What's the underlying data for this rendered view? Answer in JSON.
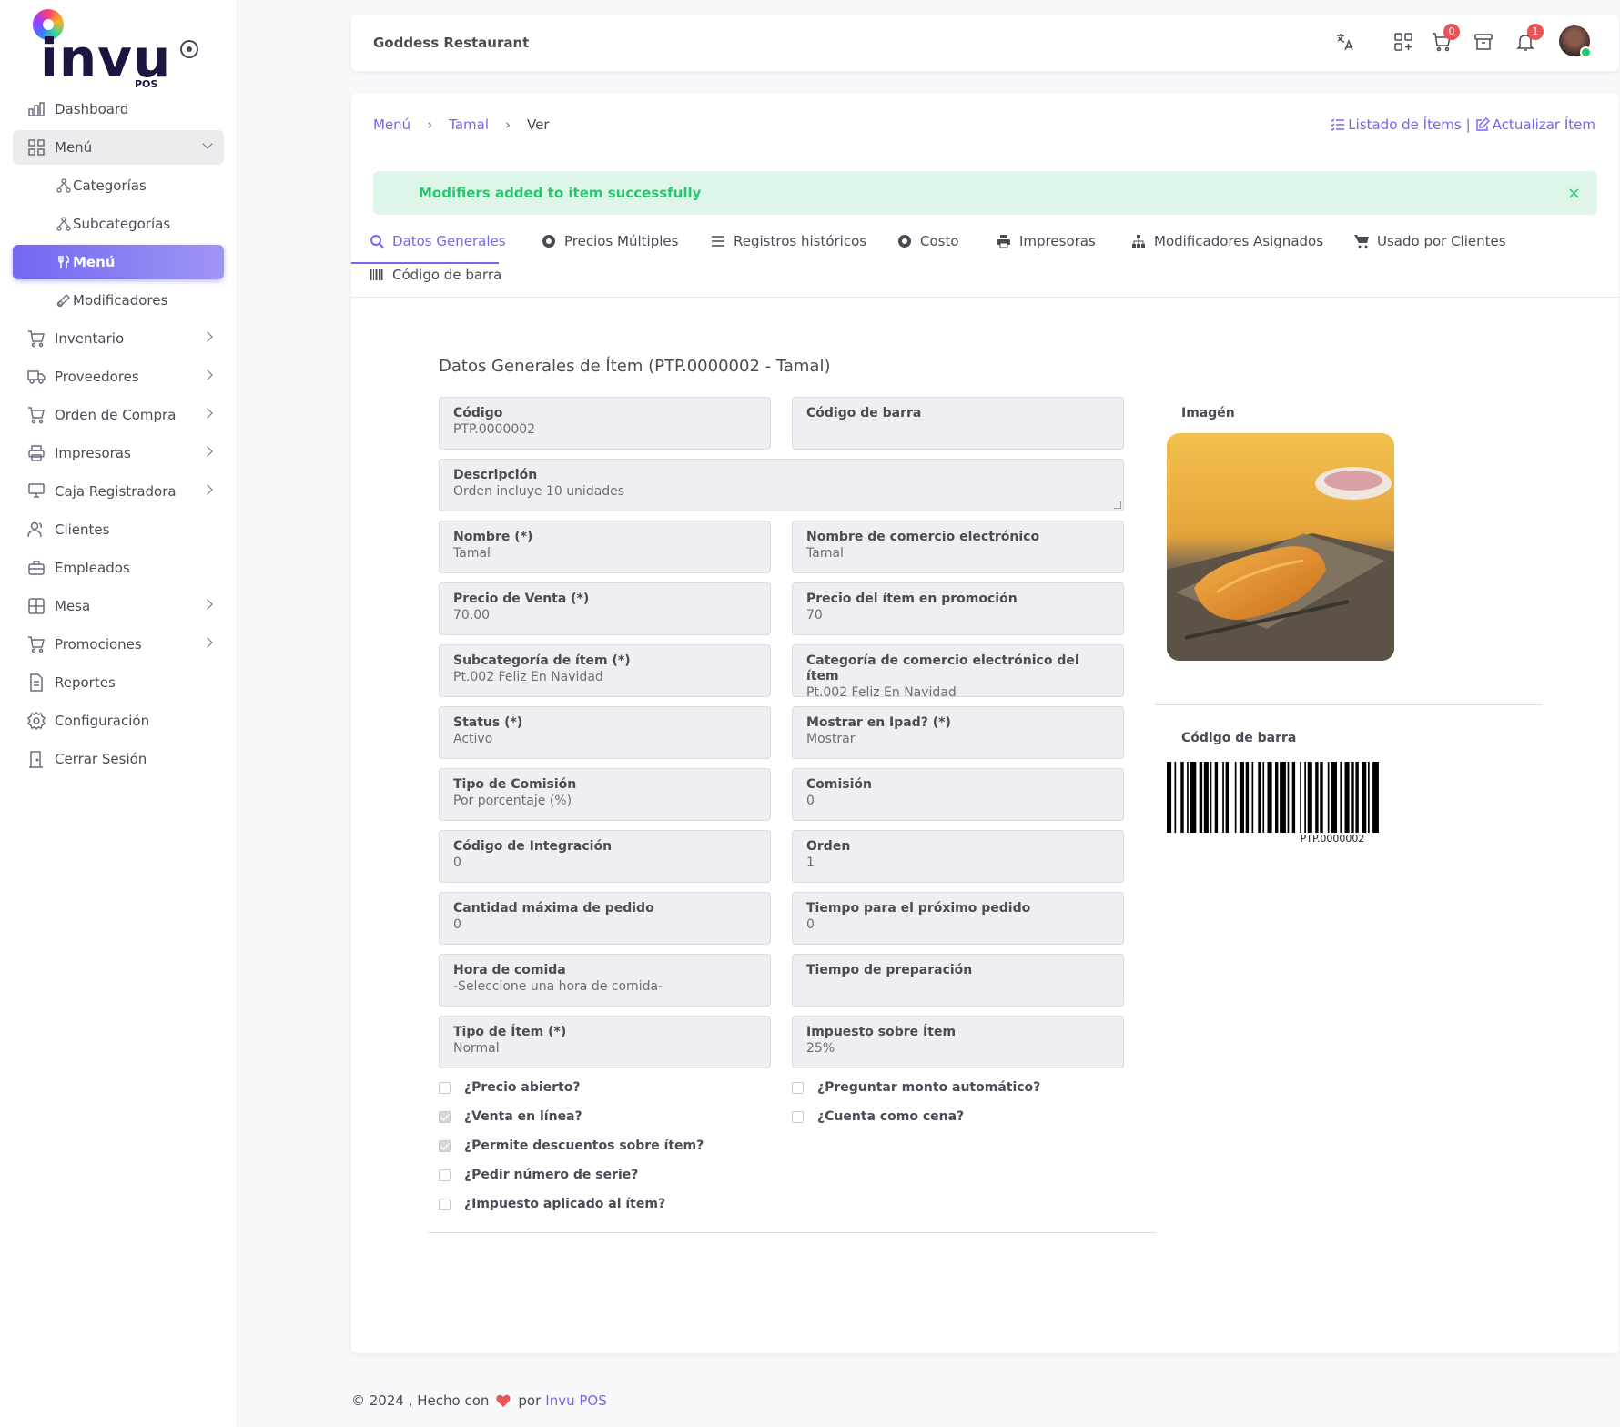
{
  "brand": {
    "name": "invu",
    "sub": "POS"
  },
  "sidebar": {
    "items": [
      {
        "label": "Dashboard",
        "icon": "chart-bar-icon"
      },
      {
        "label": "Menú",
        "icon": "grid-icon",
        "open": true,
        "children": [
          {
            "label": "Categorías",
            "icon": "hierarchy-icon"
          },
          {
            "label": "Subcategorías",
            "icon": "hierarchy-icon"
          },
          {
            "label": "Menú",
            "icon": "tools-kitchen-icon",
            "active": true
          },
          {
            "label": "Modificadores",
            "icon": "edit-circle-icon"
          }
        ]
      },
      {
        "label": "Inventario",
        "icon": "shopping-cart-icon"
      },
      {
        "label": "Proveedores",
        "icon": "truck-icon"
      },
      {
        "label": "Orden de Compra",
        "icon": "cart-icon"
      },
      {
        "label": "Impresoras",
        "icon": "printer-icon"
      },
      {
        "label": "Caja Registradora",
        "icon": "cash-register-icon"
      },
      {
        "label": "Clientes",
        "icon": "users-icon"
      },
      {
        "label": "Empleados",
        "icon": "briefcase-icon"
      },
      {
        "label": "Mesa",
        "icon": "table-icon"
      },
      {
        "label": "Promociones",
        "icon": "cart-icon"
      },
      {
        "label": "Reportes",
        "icon": "file-report-icon"
      },
      {
        "label": "Configuración",
        "icon": "settings-icon"
      },
      {
        "label": "Cerrar Sesión",
        "icon": "door-exit-icon"
      }
    ]
  },
  "topbar": {
    "title": "Goddess Restaurant",
    "cart_count": "0",
    "notif_count": "1"
  },
  "breadcrumb": {
    "items": [
      "Menú",
      "Tamal",
      "Ver"
    ]
  },
  "actions": {
    "list": "Listado de Ítems",
    "update": "Actualizar Ítem",
    "divider": "|"
  },
  "alert": {
    "message": "Modifiers added to item successfully",
    "close": "×"
  },
  "tabs": [
    {
      "label": "Datos Generales",
      "icon": "search-icon",
      "active": true
    },
    {
      "label": "Precios Múltiples",
      "icon": "coin-icon"
    },
    {
      "label": "Registros históricos",
      "icon": "list-icon"
    },
    {
      "label": "Costo",
      "icon": "coin-icon"
    },
    {
      "label": "Impresoras",
      "icon": "printer-icon"
    },
    {
      "label": "Modificadores Asignados",
      "icon": "hierarchy-icon"
    },
    {
      "label": "Usado por Clientes",
      "icon": "shopping-cart-icon"
    },
    {
      "label": "Código de barra",
      "icon": "barcode-icon"
    }
  ],
  "section": {
    "title": "Datos Generales de Ítem (PTP.0000002 - Tamal)"
  },
  "fields": {
    "codigo": {
      "label": "Código",
      "value": "PTP.0000002"
    },
    "codigo_barra": {
      "label": "Código de barra",
      "value": ""
    },
    "descripcion": {
      "label": "Descripción",
      "value": "Orden incluye 10 unidades"
    },
    "nombre": {
      "label": "Nombre (*)",
      "value": "Tamal"
    },
    "nombre_ecommerce": {
      "label": "Nombre de comercio electrónico",
      "value": "Tamal"
    },
    "precio_venta": {
      "label": "Precio de Venta (*)",
      "value": "70.00"
    },
    "precio_promocion": {
      "label": "Precio del ítem en promoción",
      "value": "70"
    },
    "subcategoria": {
      "label": "Subcategoría de ítem (*)",
      "value": "Pt.002 Feliz En Navidad"
    },
    "categoria_ecommerce": {
      "label": "Categoría de comercio electrónico del ítem",
      "value": "Pt.002 Feliz En Navidad"
    },
    "status": {
      "label": "Status (*)",
      "value": "Activo"
    },
    "mostrar_ipad": {
      "label": "Mostrar en Ipad? (*)",
      "value": "Mostrar"
    },
    "tipo_comision": {
      "label": "Tipo de Comisión",
      "value": "Por porcentaje (%)"
    },
    "comision": {
      "label": "Comisión",
      "value": "0"
    },
    "codigo_integracion": {
      "label": "Código de Integración",
      "value": "0"
    },
    "orden": {
      "label": "Orden",
      "value": "1"
    },
    "cantidad_maxima": {
      "label": "Cantidad máxima de pedido",
      "value": "0"
    },
    "tiempo_proximo": {
      "label": "Tiempo para el próximo pedido",
      "value": "0"
    },
    "hora_comida": {
      "label": "Hora de comida",
      "value": "-Seleccione una hora de comida-"
    },
    "tiempo_preparacion": {
      "label": "Tiempo de preparación",
      "value": ""
    },
    "tipo_item": {
      "label": "Tipo de Ítem (*)",
      "value": "Normal"
    },
    "impuesto": {
      "label": "Impuesto sobre Ítem",
      "value": "25%"
    }
  },
  "checkboxes": {
    "left": [
      {
        "label": "¿Precio abierto?",
        "checked": false
      },
      {
        "label": "¿Venta en línea?",
        "checked": true
      },
      {
        "label": "¿Permite descuentos sobre ítem?",
        "checked": true
      },
      {
        "label": "¿Pedir número de serie?",
        "checked": false
      },
      {
        "label": "¿Impuesto aplicado al ítem?",
        "checked": false
      }
    ],
    "right": [
      {
        "label": "¿Preguntar monto automático?",
        "checked": false
      },
      {
        "label": "¿Cuenta como cena?",
        "checked": false
      }
    ]
  },
  "image_panel": {
    "label": "Imagén"
  },
  "barcode_panel": {
    "label": "Código de barra",
    "number": "PTP.0000002"
  },
  "footer": {
    "prefix": "© 2024 , Hecho con",
    "by": "por",
    "link": "Invu POS"
  },
  "colors": {
    "primary": "#7367f0",
    "success": "#28c76f",
    "danger": "#ea5455"
  }
}
